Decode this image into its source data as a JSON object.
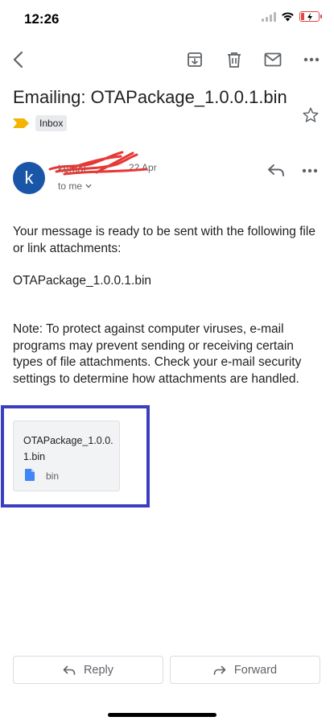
{
  "status_bar": {
    "time": "12:26"
  },
  "toolbar": {
    "back_icon": "arrow-back-icon",
    "archive_icon": "archive-icon",
    "delete_icon": "trash-icon",
    "mark_unread_icon": "mail-icon",
    "more_icon": "more-horizontal-icon"
  },
  "email": {
    "subject": "Emailing: OTAPackage_1.0.0.1.bin",
    "label": "Inbox",
    "sender_initial": "k",
    "sender_name": "kemal",
    "date": "22 Apr",
    "recipient": "to me",
    "body_paragraph_1": "Your message is ready to be sent with the following file or link attachments:",
    "body_paragraph_2": "OTAPackage_1.0.0.1.bin",
    "body_paragraph_3": "Note: To protect against computer viruses, e-mail programs may prevent sending or receiving certain types of file attachments.  Check your e-mail security settings to determine how attachments are handled."
  },
  "attachment": {
    "file_name": "OTAPackage_1.0.0.1.bin",
    "file_type": "bin"
  },
  "actions": {
    "reply_label": "Reply",
    "forward_label": "Forward"
  },
  "colors": {
    "avatar": "#1a56a8",
    "highlight_border": "#3b3ec0",
    "label_marker": "#f4b400",
    "file_icon": "#4285f4",
    "redaction": "#e53935"
  }
}
